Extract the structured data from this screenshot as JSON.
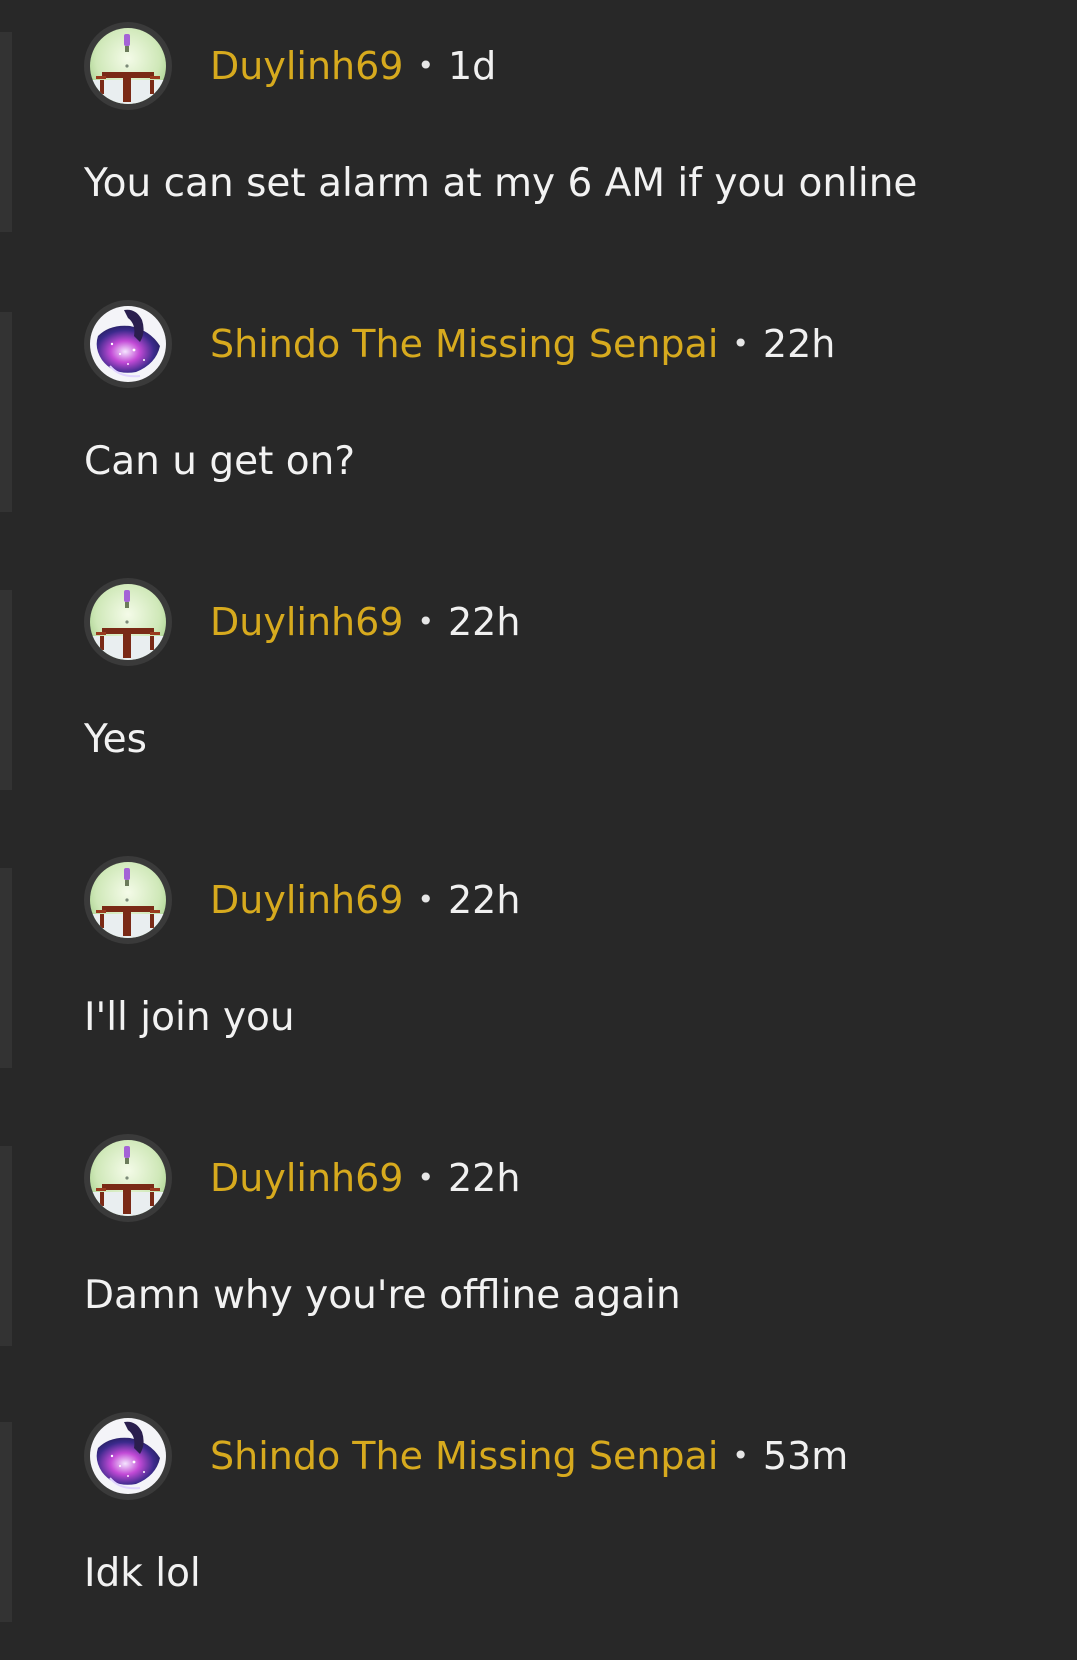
{
  "colors": {
    "background": "#282828",
    "username": "#d7aa1e",
    "text": "#f2f2f2",
    "thread_line": "#333333"
  },
  "separator": "•",
  "comments": [
    {
      "author": "Duylinh69",
      "time": "1d",
      "text": "You can set alarm at my 6 AM if you online",
      "avatar": "room-avatar"
    },
    {
      "author": "Shindo The Missing Senpai",
      "time": "22h",
      "text": "Can u get on?",
      "avatar": "galaxy-avatar"
    },
    {
      "author": "Duylinh69",
      "time": "22h",
      "text": "Yes",
      "avatar": "room-avatar"
    },
    {
      "author": "Duylinh69",
      "time": "22h",
      "text": "I'll join you",
      "avatar": "room-avatar"
    },
    {
      "author": "Duylinh69",
      "time": "22h",
      "text": "Damn why you're offline again",
      "avatar": "room-avatar"
    },
    {
      "author": "Shindo The Missing Senpai",
      "time": "53m",
      "text": "Idk lol",
      "avatar": "galaxy-avatar"
    }
  ]
}
